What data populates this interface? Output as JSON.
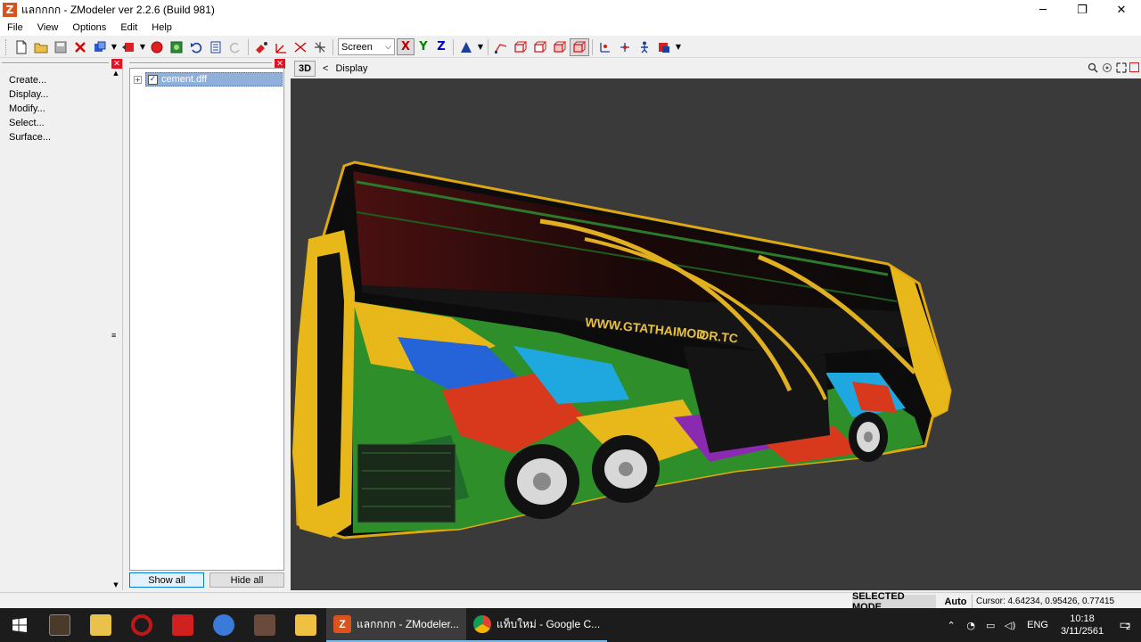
{
  "window": {
    "title": "แลกกกก - ZModeler ver 2.2.6 (Build 981)",
    "icon_letter": "Z",
    "controls": {
      "minimize": "─",
      "maximize": "❐",
      "close": "✕"
    }
  },
  "menu": [
    "File",
    "View",
    "Options",
    "Edit",
    "Help"
  ],
  "toolbar": {
    "space_select": "Screen",
    "axes": {
      "x": "X",
      "y": "Y",
      "z": "Z"
    },
    "axis_colors": {
      "x": "#c00000",
      "y": "#008000",
      "z": "#0000c0"
    }
  },
  "command_panel": {
    "items": [
      "Create...",
      "Display...",
      "Modify...",
      "Select...",
      "Surface..."
    ]
  },
  "tree": {
    "item": "cement.dff",
    "checked": true,
    "show_all": "Show all",
    "hide_all": "Hide all"
  },
  "viewport": {
    "mode_label": "3D",
    "back": "<",
    "section": "Display",
    "overlay_text": "WWW.GTATHAIMOD",
    "overlay_text_tail": "OR.TC",
    "background": "#3a3a3a"
  },
  "status": {
    "mode": "SELECTED MODE",
    "auto": "Auto",
    "cursor": "Cursor: 4.64234, 0.95426, 0.77415"
  },
  "taskbar": {
    "tasks": [
      {
        "label": "แลกกกก - ZModeler...",
        "active": true
      },
      {
        "label": "แท็บใหม่ - Google C...",
        "active": false
      }
    ],
    "lang": "ENG",
    "time": "10:18",
    "date": "3/11/2561",
    "notifications": "2"
  }
}
